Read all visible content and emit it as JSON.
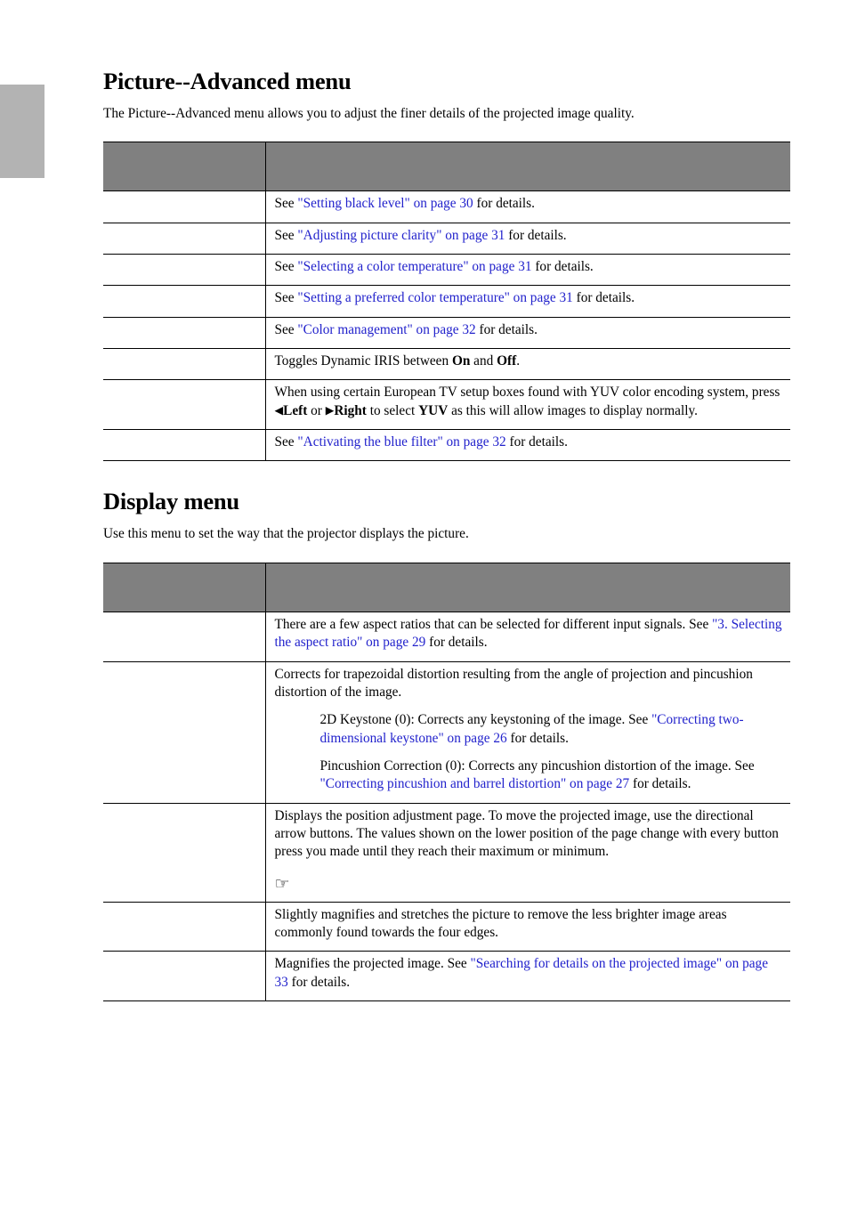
{
  "page": {
    "side_tab_present": true,
    "link_color": "#2222cc",
    "header_fill": "#808080",
    "side_tab_color": "#b3b3b3"
  },
  "sections": [
    {
      "id": "picture-advanced",
      "title": "Picture--Advanced menu",
      "intro": "The Picture--Advanced menu allows you to adjust the finer details of the projected image quality.",
      "table": {
        "header": {
          "label": "",
          "description": ""
        },
        "rows": [
          {
            "label": "",
            "paragraphs": [
              {
                "indent": false,
                "runs": [
                  {
                    "t": "See ",
                    "style": "plain"
                  },
                  {
                    "t": "\"Setting black level\" on page 30",
                    "style": "link"
                  },
                  {
                    "t": " for details.",
                    "style": "plain"
                  }
                ]
              }
            ]
          },
          {
            "label": "",
            "paragraphs": [
              {
                "indent": false,
                "runs": [
                  {
                    "t": "See ",
                    "style": "plain"
                  },
                  {
                    "t": "\"Adjusting picture clarity\" on page 31",
                    "style": "link"
                  },
                  {
                    "t": " for details.",
                    "style": "plain"
                  }
                ]
              }
            ]
          },
          {
            "label": "",
            "paragraphs": [
              {
                "indent": false,
                "runs": [
                  {
                    "t": "See ",
                    "style": "plain"
                  },
                  {
                    "t": "\"Selecting a color temperature\" on page 31",
                    "style": "link"
                  },
                  {
                    "t": " for details.",
                    "style": "plain"
                  }
                ]
              }
            ]
          },
          {
            "label": "",
            "paragraphs": [
              {
                "indent": false,
                "runs": [
                  {
                    "t": "See ",
                    "style": "plain"
                  },
                  {
                    "t": "\"Setting a preferred color temperature\" on page 31",
                    "style": "link"
                  },
                  {
                    "t": " for details.",
                    "style": "plain"
                  }
                ]
              }
            ]
          },
          {
            "label": "",
            "paragraphs": [
              {
                "indent": false,
                "runs": [
                  {
                    "t": "See ",
                    "style": "plain"
                  },
                  {
                    "t": "\"Color management\" on page 32",
                    "style": "link"
                  },
                  {
                    "t": " for details.",
                    "style": "plain"
                  }
                ]
              }
            ]
          },
          {
            "label": "",
            "paragraphs": [
              {
                "indent": false,
                "runs": [
                  {
                    "t": "Toggles Dynamic IRIS between ",
                    "style": "plain"
                  },
                  {
                    "t": "On",
                    "style": "bold"
                  },
                  {
                    "t": " and ",
                    "style": "plain"
                  },
                  {
                    "t": "Off",
                    "style": "bold"
                  },
                  {
                    "t": ".",
                    "style": "plain"
                  }
                ]
              }
            ]
          },
          {
            "label": "",
            "paragraphs": [
              {
                "indent": false,
                "runs": [
                  {
                    "t": "When using certain European TV setup boxes found with YUV color encoding system, press ",
                    "style": "plain"
                  },
                  {
                    "t": "◀",
                    "style": "arrow"
                  },
                  {
                    "t": "Left",
                    "style": "bold"
                  },
                  {
                    "t": " or ",
                    "style": "plain"
                  },
                  {
                    "t": "▶",
                    "style": "arrow"
                  },
                  {
                    "t": "Right",
                    "style": "bold"
                  },
                  {
                    "t": " to select ",
                    "style": "plain"
                  },
                  {
                    "t": "YUV",
                    "style": "bold"
                  },
                  {
                    "t": " as this will allow images to display normally.",
                    "style": "plain"
                  }
                ]
              }
            ]
          },
          {
            "label": "",
            "paragraphs": [
              {
                "indent": false,
                "runs": [
                  {
                    "t": "See ",
                    "style": "plain"
                  },
                  {
                    "t": "\"Activating the blue filter\" on page 32",
                    "style": "link"
                  },
                  {
                    "t": " for details.",
                    "style": "plain"
                  }
                ]
              }
            ]
          }
        ]
      }
    },
    {
      "id": "display-menu",
      "title": "Display menu",
      "intro": "Use this menu to set the way that the projector displays the picture.",
      "table": {
        "header": {
          "label": "",
          "description": ""
        },
        "rows": [
          {
            "label": "",
            "paragraphs": [
              {
                "indent": false,
                "runs": [
                  {
                    "t": "There are a few aspect ratios that can be selected for different input signals. See ",
                    "style": "plain"
                  },
                  {
                    "t": "\"3. Selecting the aspect ratio\" on page 29",
                    "style": "link"
                  },
                  {
                    "t": " for details.",
                    "style": "plain"
                  }
                ]
              }
            ]
          },
          {
            "label": "",
            "paragraphs": [
              {
                "indent": false,
                "runs": [
                  {
                    "t": "Corrects for trapezoidal distortion resulting from the angle of projection and pincushion distortion of the image.",
                    "style": "plain"
                  }
                ]
              },
              {
                "indent": true,
                "runs": [
                  {
                    "t": "2D Keystone (0): Corrects any keystoning of the image. See ",
                    "style": "plain"
                  },
                  {
                    "t": "\"Correcting two-dimensional keystone\" on page 26",
                    "style": "link"
                  },
                  {
                    "t": " for details.",
                    "style": "plain"
                  }
                ]
              },
              {
                "indent": true,
                "runs": [
                  {
                    "t": "Pincushion Correction (0): Corrects any pincushion distortion of the image. See ",
                    "style": "plain"
                  },
                  {
                    "t": "\"Correcting pincushion and barrel distortion\" on page 27",
                    "style": "link"
                  },
                  {
                    "t": " for details.",
                    "style": "plain"
                  }
                ]
              }
            ]
          },
          {
            "label": "",
            "paragraphs": [
              {
                "indent": false,
                "runs": [
                  {
                    "t": "Displays the position adjustment page. To move the projected image, use the directional arrow buttons. The values shown on the lower position of the page change with every button press you made until they reach their maximum or minimum.",
                    "style": "plain"
                  }
                ]
              }
            ],
            "note_icon": "☞",
            "note_text": ""
          },
          {
            "label": "",
            "paragraphs": [
              {
                "indent": false,
                "runs": [
                  {
                    "t": "Slightly magnifies and stretches the picture to remove the less brighter image areas commonly found towards the four edges.",
                    "style": "plain"
                  }
                ]
              }
            ]
          },
          {
            "label": "",
            "paragraphs": [
              {
                "indent": false,
                "runs": [
                  {
                    "t": "Magnifies the projected image. See ",
                    "style": "plain"
                  },
                  {
                    "t": "\"Searching for details on the projected image\" on page 33",
                    "style": "link"
                  },
                  {
                    "t": " for details.",
                    "style": "plain"
                  }
                ]
              }
            ]
          }
        ]
      }
    }
  ]
}
